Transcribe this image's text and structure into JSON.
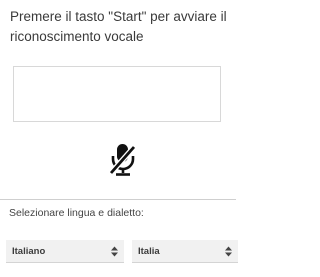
{
  "instruction": "Premere il tasto \"Start\" per avviare il riconoscimento vocale",
  "transcript": {
    "text": ""
  },
  "mic": {
    "icon": "mic-off-icon",
    "state": "off"
  },
  "language": {
    "label": "Selezionare lingua e dialetto:",
    "language_select": {
      "selected": "Italiano",
      "icon": "select-arrows-icon"
    },
    "dialect_select": {
      "selected": "Italia",
      "icon": "select-arrows-icon"
    }
  }
}
